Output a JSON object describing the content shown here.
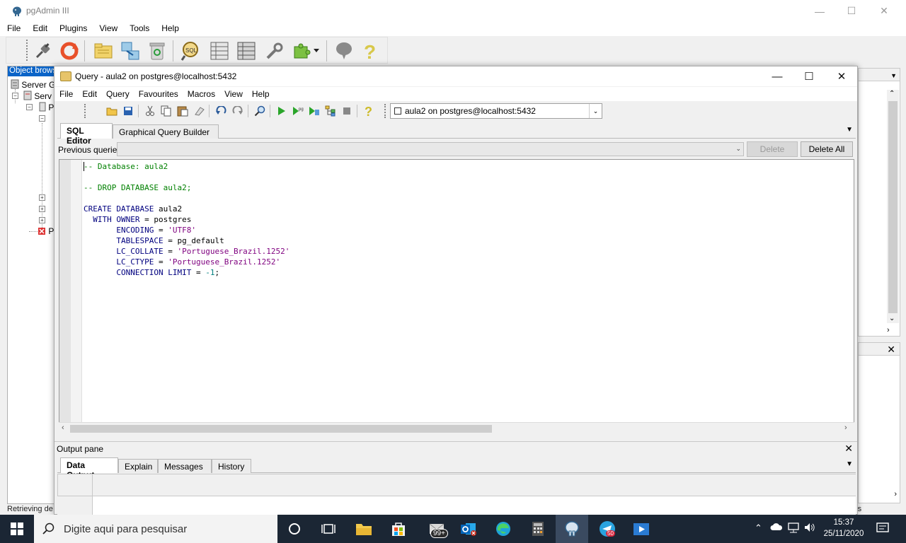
{
  "main_window": {
    "title": "pgAdmin III",
    "menu": [
      "File",
      "Edit",
      "Plugins",
      "View",
      "Tools",
      "Help"
    ],
    "object_browser": {
      "header": "Object brows",
      "tree": [
        "Server G",
        "Serv",
        "P",
        "P"
      ]
    },
    "status_text": "Retrieving de",
    "status_right": "rs"
  },
  "query_window": {
    "title": "Query - aula2 on postgres@localhost:5432",
    "menu": [
      "File",
      "Edit",
      "Query",
      "Favourites",
      "Macros",
      "View",
      "Help"
    ],
    "connection": "aula2 on postgres@localhost:5432",
    "editor_tabs": [
      "SQL Editor",
      "Graphical Query Builder"
    ],
    "previous_queries_label": "Previous queries",
    "delete_label": "Delete",
    "delete_all_label": "Delete All",
    "code": [
      {
        "parts": [
          {
            "t": "-- Database: aula2",
            "c": "comment"
          }
        ]
      },
      {
        "parts": []
      },
      {
        "parts": [
          {
            "t": "-- DROP DATABASE aula2;",
            "c": "comment"
          }
        ]
      },
      {
        "parts": []
      },
      {
        "parts": [
          {
            "t": "CREATE DATABASE ",
            "c": "kw"
          },
          {
            "t": "aula2",
            "c": "plain"
          }
        ]
      },
      {
        "parts": [
          {
            "t": "  WITH OWNER ",
            "c": "kw"
          },
          {
            "t": "= postgres",
            "c": "plain"
          }
        ]
      },
      {
        "parts": [
          {
            "t": "       ENCODING ",
            "c": "kw"
          },
          {
            "t": "= ",
            "c": "plain"
          },
          {
            "t": "'UTF8'",
            "c": "str"
          }
        ]
      },
      {
        "parts": [
          {
            "t": "       TABLESPACE ",
            "c": "kw"
          },
          {
            "t": "= pg_default",
            "c": "plain"
          }
        ]
      },
      {
        "parts": [
          {
            "t": "       LC_COLLATE ",
            "c": "kw"
          },
          {
            "t": "= ",
            "c": "plain"
          },
          {
            "t": "'Portuguese_Brazil.1252'",
            "c": "str"
          }
        ]
      },
      {
        "parts": [
          {
            "t": "       LC_CTYPE ",
            "c": "kw"
          },
          {
            "t": "= ",
            "c": "plain"
          },
          {
            "t": "'Portuguese_Brazil.1252'",
            "c": "str"
          }
        ]
      },
      {
        "parts": [
          {
            "t": "       CONNECTION LIMIT ",
            "c": "kw"
          },
          {
            "t": "= ",
            "c": "plain"
          },
          {
            "t": "-1",
            "c": "num"
          },
          {
            "t": ";",
            "c": "plain"
          }
        ]
      }
    ],
    "output_pane_label": "Output pane",
    "output_tabs": [
      "Data Output",
      "Explain",
      "Messages",
      "History"
    ]
  },
  "taskbar": {
    "search_placeholder": "Digite aqui para pesquisar",
    "mail_badge": "99+",
    "telegram_badge": "50",
    "time": "15:37",
    "date": "25/11/2020"
  },
  "colors": {
    "comment": "#008000",
    "keyword": "#00007f",
    "string": "#7f007f",
    "taskbar": "#1b2634",
    "selection": "#0a64c8"
  }
}
